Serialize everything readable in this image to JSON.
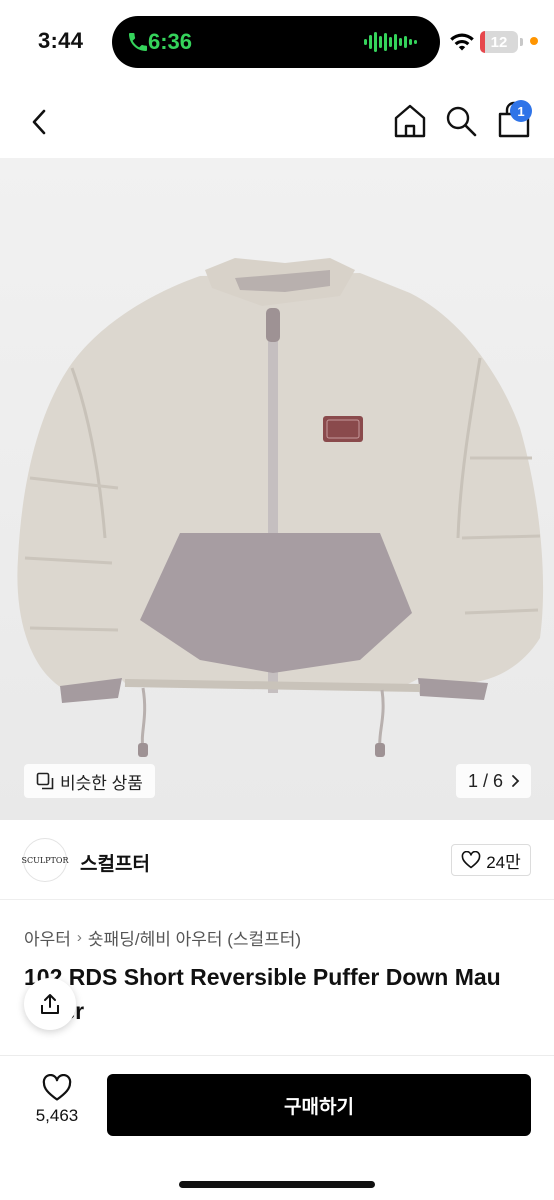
{
  "status_bar": {
    "time": "3:44",
    "call_duration": "6:36",
    "battery": "12",
    "battery_level": 0.12,
    "accent_call_color": "#35d35b",
    "battery_color": "#e6474c"
  },
  "nav": {
    "back_icon": "chevron-left-icon",
    "home_icon": "home-icon",
    "search_icon": "search-icon",
    "cart_icon": "cart-icon",
    "cart_badge": "1",
    "badge_color": "#2f74e8"
  },
  "gallery": {
    "similar_label": "비슷한 상품",
    "pager": "1 / 6"
  },
  "brand": {
    "logo_text": "SCULPTOR",
    "name": "스컬프터",
    "likes": "24만"
  },
  "breadcrumb": {
    "items": [
      "아우터",
      "숏패딩/헤비 아우터 (스컬프터)"
    ]
  },
  "product": {
    "title": "102 RDS Short Reversible Puffer Down Mau\n   lver"
  },
  "bottom_bar": {
    "wish_count": "5,463",
    "buy_label": "구매하기"
  }
}
